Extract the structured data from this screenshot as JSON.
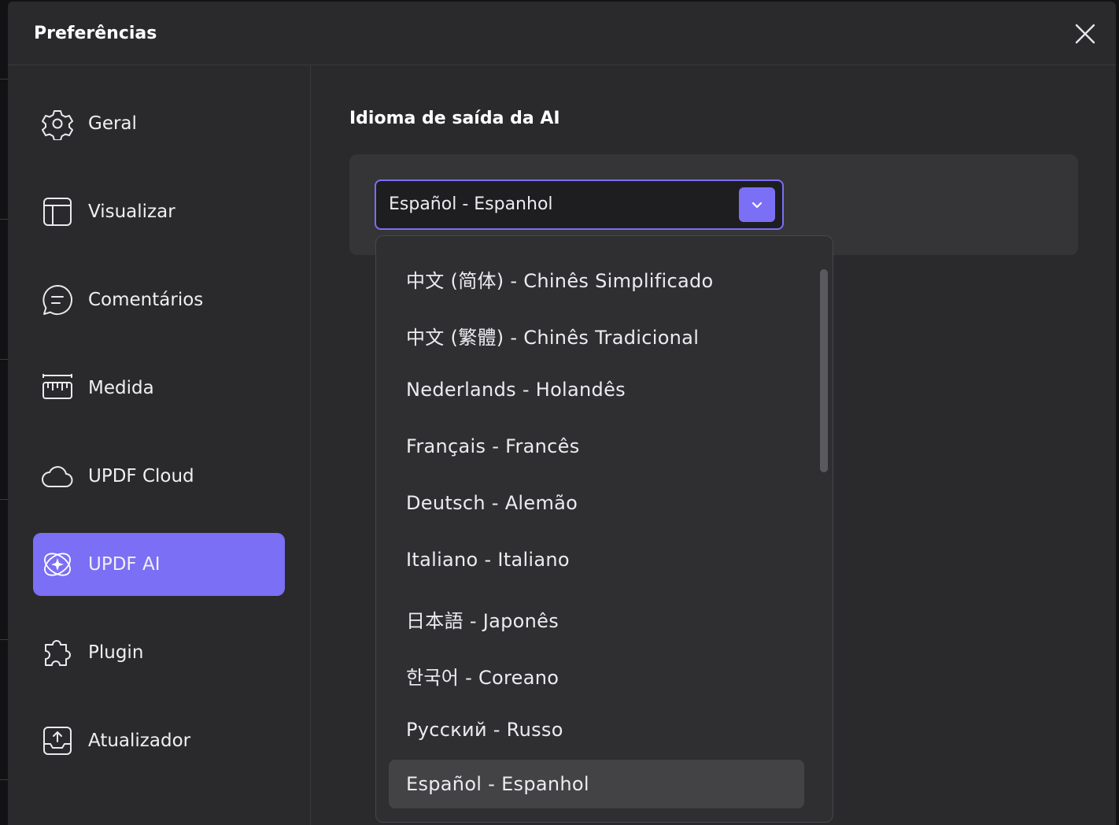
{
  "window": {
    "title": "Preferências",
    "close_icon": "close-icon"
  },
  "sidebar": {
    "items": [
      {
        "label": "Geral",
        "icon": "gear-icon",
        "active": false
      },
      {
        "label": "Visualizar",
        "icon": "layout-icon",
        "active": false
      },
      {
        "label": "Comentários",
        "icon": "comment-icon",
        "active": false
      },
      {
        "label": "Medida",
        "icon": "ruler-icon",
        "active": false
      },
      {
        "label": "UPDF Cloud",
        "icon": "cloud-icon",
        "active": false
      },
      {
        "label": "UPDF AI",
        "icon": "ai-sparkle-icon",
        "active": true
      },
      {
        "label": "Plugin",
        "icon": "puzzle-icon",
        "active": false
      },
      {
        "label": "Atualizador",
        "icon": "update-icon",
        "active": false
      }
    ]
  },
  "main": {
    "section_title": "Idioma de saída da AI",
    "language_select": {
      "value": "Español - Espanhol",
      "icon": "chevron-down-icon"
    },
    "dropdown": {
      "options": [
        {
          "label": "中文 (简体) - Chinês Simplificado"
        },
        {
          "label": "中文 (繁體) - Chinês Tradicional"
        },
        {
          "label": "Nederlands - Holandês"
        },
        {
          "label": "Français - Francês"
        },
        {
          "label": "Deutsch - Alemão"
        },
        {
          "label": "Italiano - Italiano"
        },
        {
          "label": "日本語 - Japonês"
        },
        {
          "label": "한국어 - Coreano"
        },
        {
          "label": "Русский - Russo"
        },
        {
          "label": "Español - Espanhol",
          "selected": true
        }
      ]
    }
  },
  "colors": {
    "accent": "#7b6ff5",
    "dialog_bg": "#2a2a2d",
    "card_bg": "#353538",
    "dropdown_bg": "#2f2f32",
    "selected_option_bg": "#434346"
  }
}
